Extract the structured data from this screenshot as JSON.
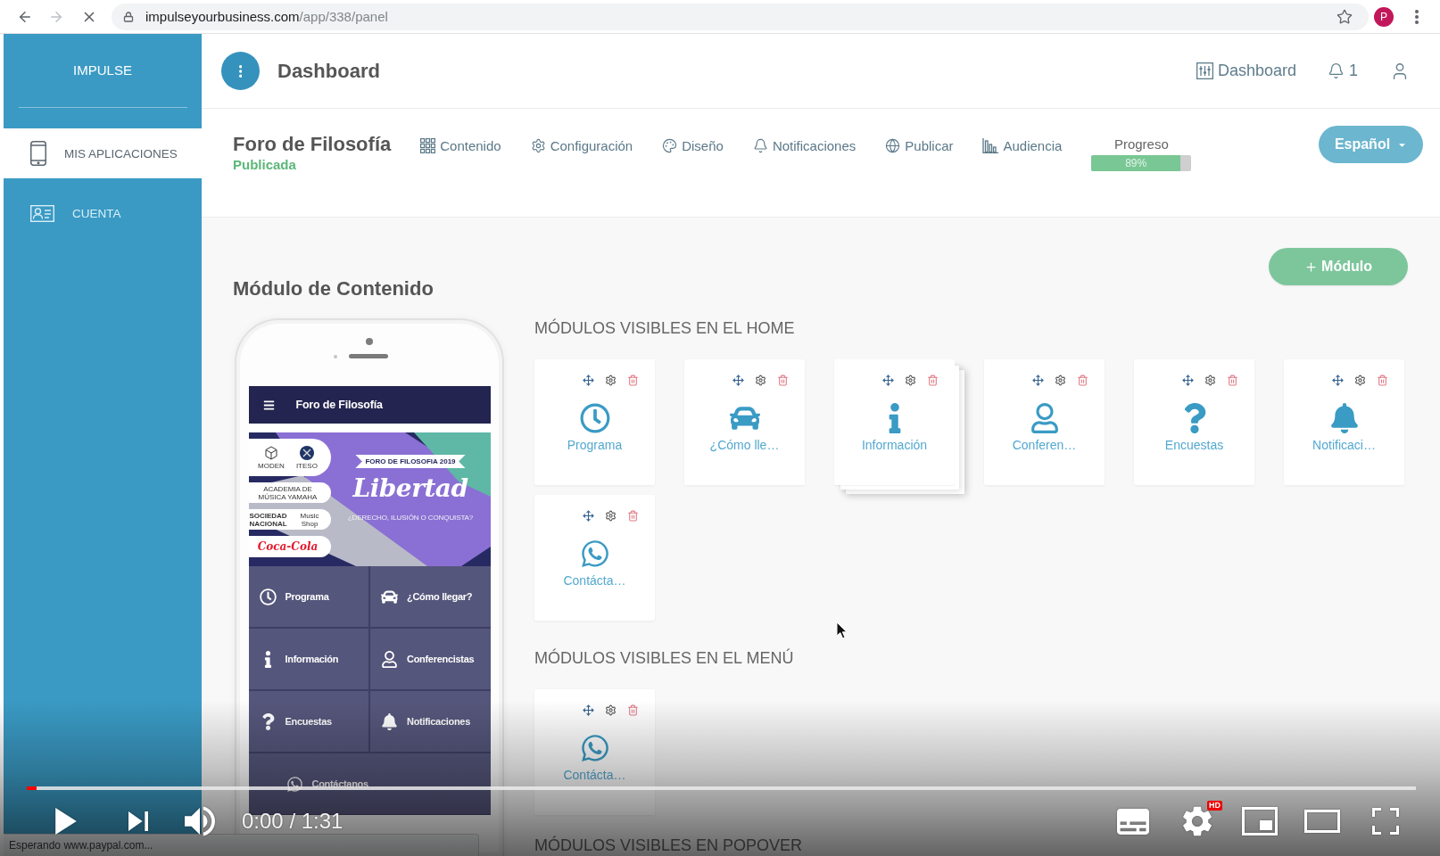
{
  "browser": {
    "forward_disabled": true,
    "loading": true,
    "url_host": "impulseyourbusiness.com",
    "url_path": "/app/338/panel",
    "profile_initial": "P"
  },
  "sidebar": {
    "brand": "IMPULSE",
    "items": [
      {
        "label": "MIS APLICACIONES",
        "selected": true
      },
      {
        "label": "CUENTA",
        "selected": false
      }
    ]
  },
  "header": {
    "title": "Dashboard",
    "dashboard_link": "Dashboard",
    "notification_count": "1"
  },
  "app_bar": {
    "name": "Foro de Filosofía",
    "status": "Publicada",
    "nav": [
      "Contenido",
      "Configuración",
      "Diseño",
      "Notificaciones",
      "Publicar",
      "Audiencia"
    ],
    "progress": {
      "label": "Progreso",
      "level": 0.89,
      "reading": "89%"
    },
    "language": "Español"
  },
  "content": {
    "title": "Módulo de Contenido",
    "add_button": "Módulo"
  },
  "phone_preview": {
    "app_title": "Foro de Filosofía",
    "banner": {
      "sponsors": [
        {
          "kind": "logos",
          "names": [
            "MODEN",
            "ITESO"
          ]
        },
        {
          "kind": "text",
          "names": [
            "ACADEMIA DE MÚSICA YAMAHA"
          ]
        },
        {
          "kind": "text",
          "names": [
            "SOCIEDAD NACIONAL",
            "Music Shop"
          ]
        },
        {
          "kind": "script",
          "names": [
            "Coca-Cola"
          ]
        }
      ],
      "ribbon": "FORO DE FILOSOFIA 2019",
      "headline": "Libertad",
      "tagline": "¿DERECHO, ILUSIÓN O CONQUISTA?"
    },
    "menu": [
      {
        "label": "Programa",
        "kind": "schedule"
      },
      {
        "label": "¿Cómo llegar?",
        "kind": "directions"
      },
      {
        "label": "Información",
        "kind": "info"
      },
      {
        "label": "Conferencistas",
        "kind": "speakers"
      },
      {
        "label": "Encuestas",
        "kind": "surveys"
      },
      {
        "label": "Notificaciones",
        "kind": "notifications"
      },
      {
        "label": "Contáctanos",
        "kind": "contact"
      }
    ]
  },
  "sections": [
    {
      "title": "MÓDULOS VISIBLES EN EL HOME",
      "modules": [
        {
          "label": "Programa",
          "kind": "schedule",
          "dragging": false
        },
        {
          "label": "¿Cómo lle…",
          "kind": "directions",
          "dragging": false
        },
        {
          "label": "Información",
          "kind": "info",
          "dragging": true
        },
        {
          "label": "Conferen…",
          "kind": "speakers",
          "dragging": false
        },
        {
          "label": "Encuestas",
          "kind": "surveys",
          "dragging": false
        },
        {
          "label": "Notificaci…",
          "kind": "notifications",
          "dragging": false
        },
        {
          "label": "Contácta…",
          "kind": "contact",
          "dragging": false
        }
      ]
    },
    {
      "title": "MÓDULOS VISIBLES EN EL MENÚ",
      "modules": [
        {
          "label": "Contácta…",
          "kind": "contact",
          "dragging": false
        }
      ]
    },
    {
      "title": "MÓDULOS VISIBLES EN POPOVER"
    }
  ],
  "status_bubble": "Esperando www.paypal.com...",
  "player": {
    "playing": false,
    "level": 0.007,
    "time": "0:00 / 1:31",
    "quality_badge": "HD"
  }
}
